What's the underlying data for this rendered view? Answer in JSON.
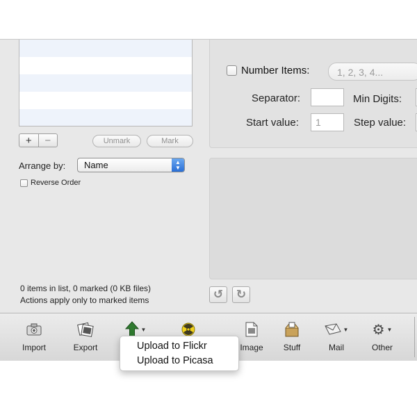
{
  "list": {
    "add_label": "+",
    "remove_label": "−",
    "unmark_label": "Unmark",
    "mark_label": "Mark"
  },
  "arrange": {
    "label": "Arrange by:",
    "value": "Name",
    "reverse_label": "Reverse Order",
    "reverse_checked": false
  },
  "status": {
    "line1": "0 items in list, 0 marked (0 KB files)",
    "line2": "Actions apply only to marked items"
  },
  "numbering": {
    "number_items_label": "Number Items:",
    "number_items_checked": false,
    "format_value": "1, 2, 3, 4...",
    "separator_label": "Separator:",
    "separator_value": "",
    "min_digits_label": "Min Digits:",
    "start_value_label": "Start value:",
    "start_value": "1",
    "step_value_label": "Step value:"
  },
  "rotate": {
    "left_glyph": "↺",
    "right_glyph": "↻"
  },
  "toolbar": {
    "import_label": "Import",
    "export_label": "Export",
    "image_label": "Image",
    "stuff_label": "Stuff",
    "mail_label": "Mail",
    "other_label": "Other",
    "icons": [
      "camera-icon",
      "photos-icon",
      "upload-arrow-icon",
      "radiation-icon",
      "document-icon",
      "box-icon",
      "mail-icon",
      "gear-icon"
    ]
  },
  "upload_menu": {
    "items": [
      "Upload to Flickr",
      "Upload to Picasa"
    ]
  },
  "colors": {
    "window_bg": "#e8e8e8",
    "list_stripe": "#eef3fb",
    "popup_accent": "#2a6fd6",
    "upload_arrow": "#2f7a2f"
  }
}
